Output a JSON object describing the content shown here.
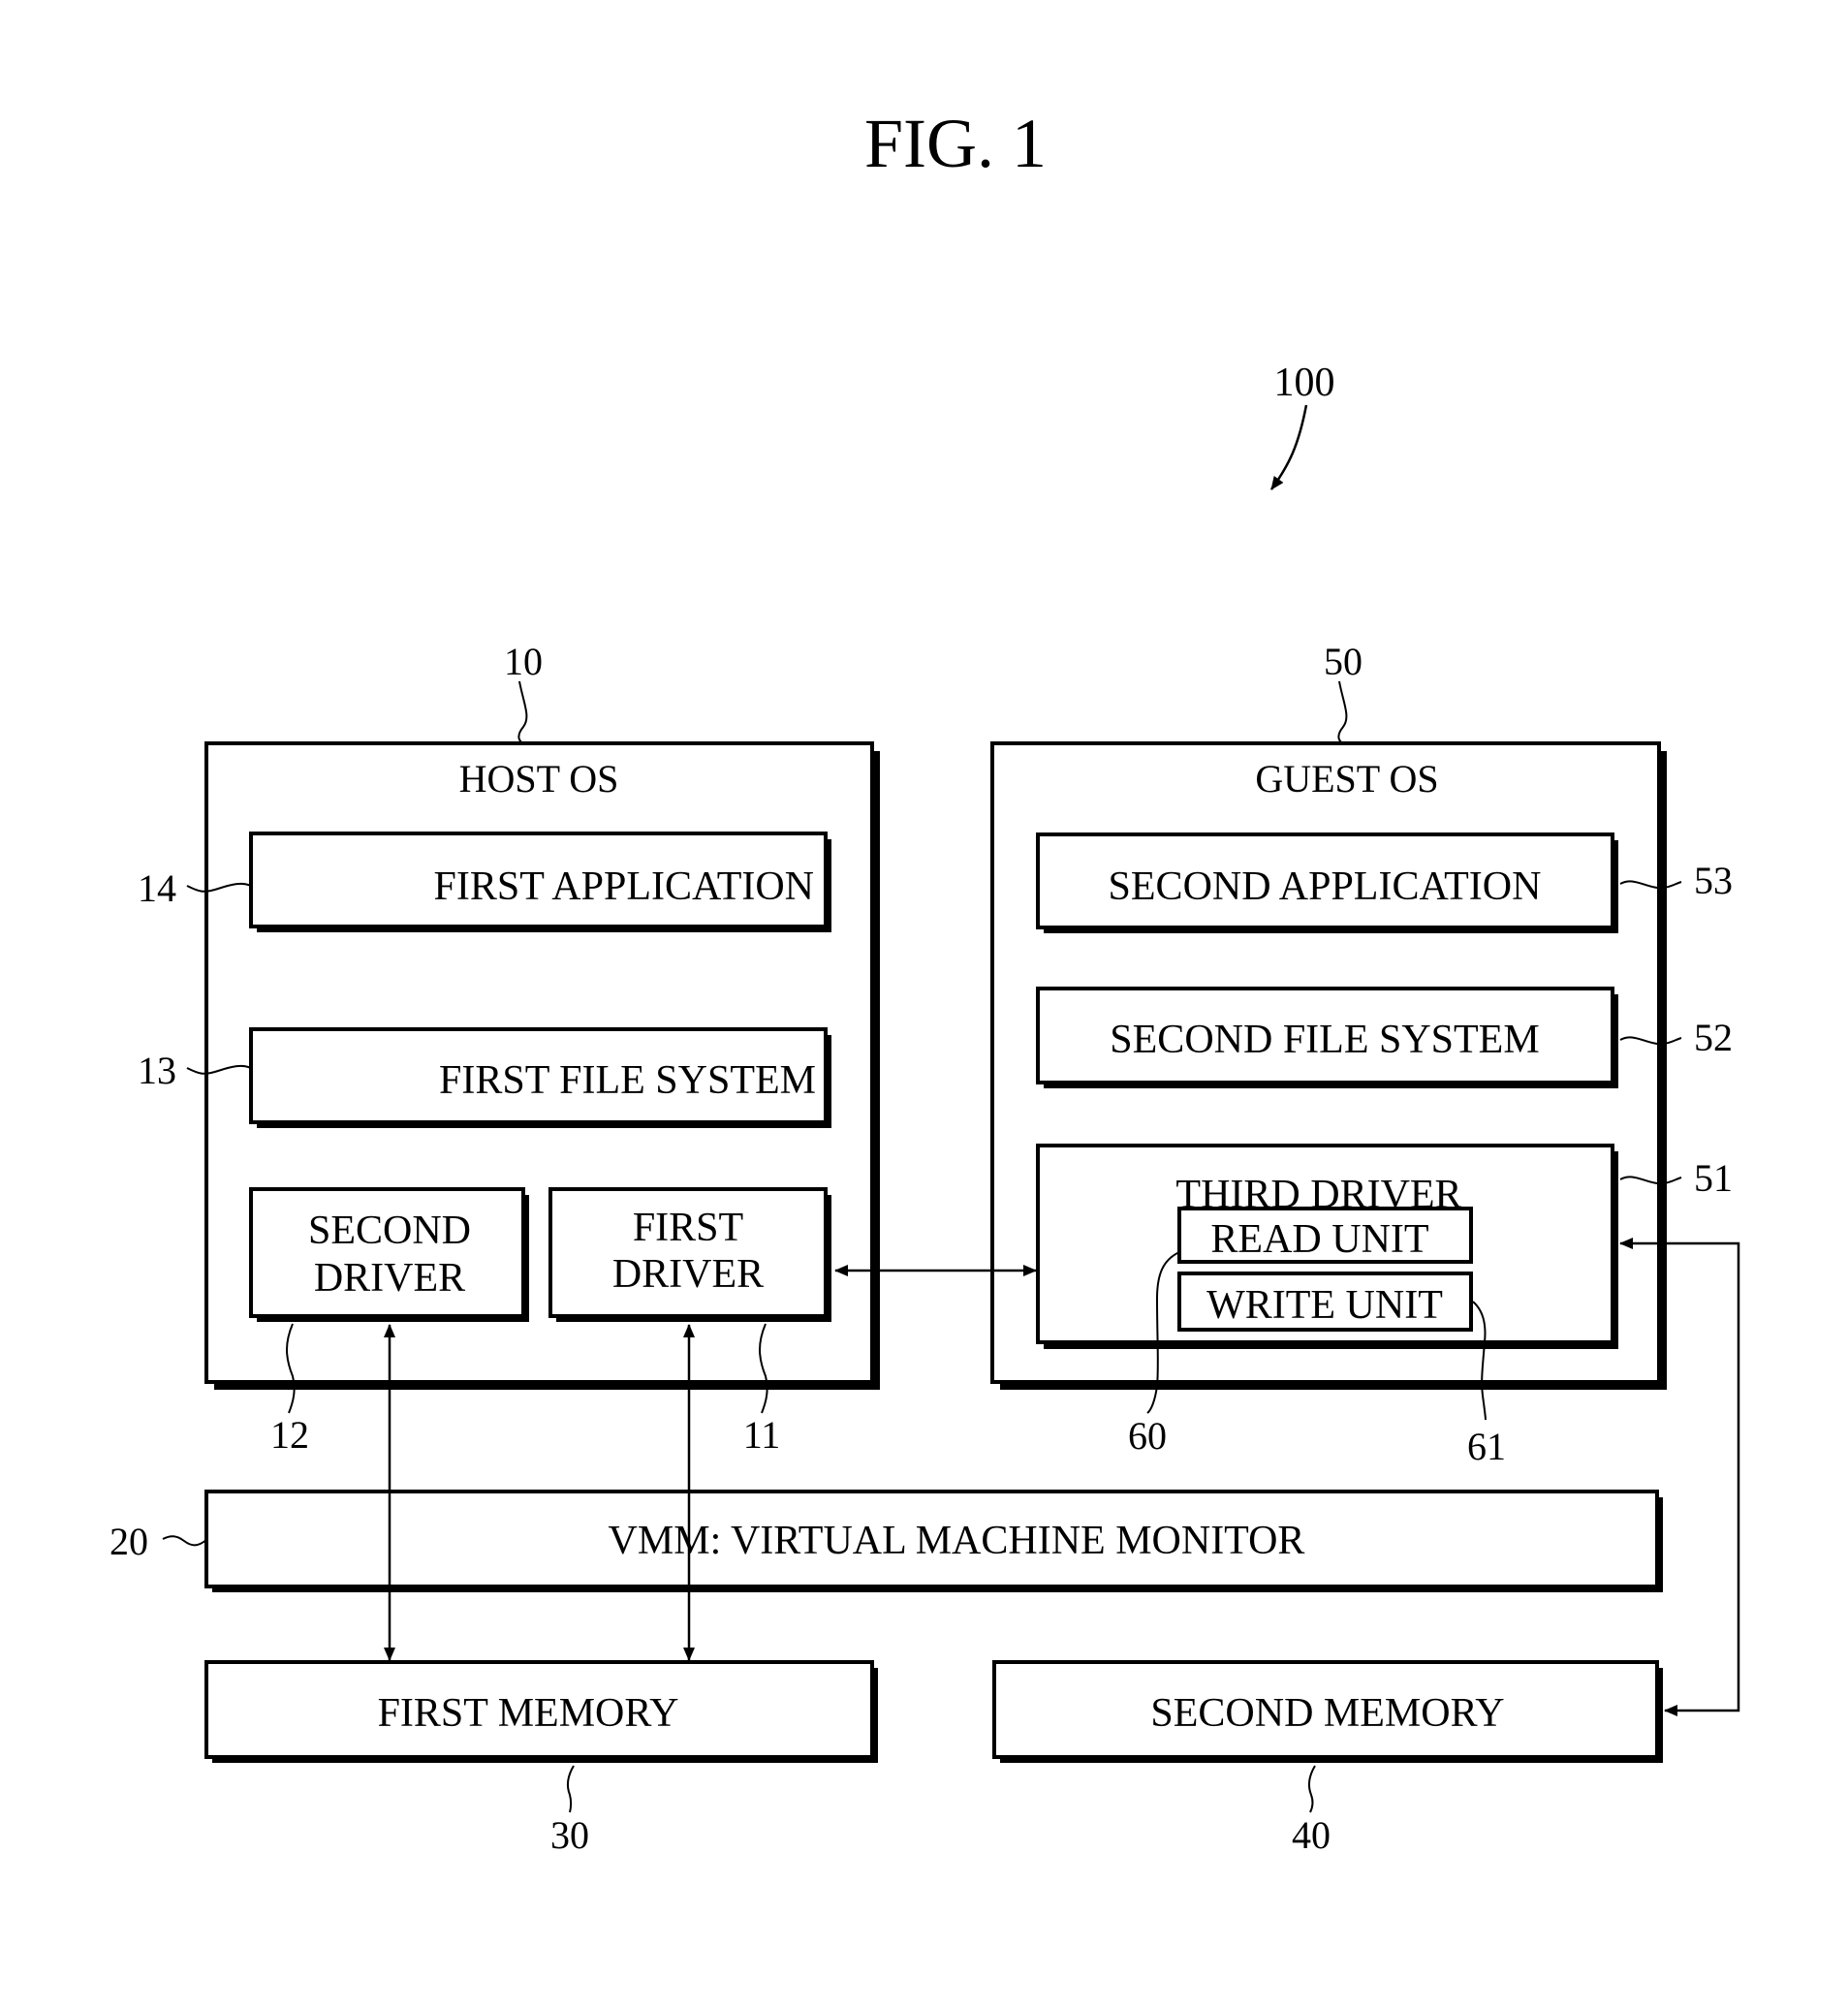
{
  "figure": {
    "title": "FIG. 1",
    "system_ref": "100"
  },
  "host_os": {
    "ref": "10",
    "title": "HOST OS",
    "first_application": {
      "ref": "14",
      "label": "FIRST APPLICATION"
    },
    "first_file_system": {
      "ref": "13",
      "label": "FIRST FILE SYSTEM"
    },
    "second_driver": {
      "ref": "12",
      "label_line1": "SECOND",
      "label_line2": "DRIVER"
    },
    "first_driver": {
      "ref": "11",
      "label_line1": "FIRST",
      "label_line2": "DRIVER"
    }
  },
  "guest_os": {
    "ref": "50",
    "title": "GUEST OS",
    "second_application": {
      "ref": "53",
      "label": "SECOND APPLICATION"
    },
    "second_file_system": {
      "ref": "52",
      "label": "SECOND FILE SYSTEM"
    },
    "third_driver": {
      "ref": "51",
      "label": "THIRD DRIVER",
      "read_unit": {
        "ref": "60",
        "label": "READ UNIT"
      },
      "write_unit": {
        "ref": "61",
        "label": "WRITE UNIT"
      }
    }
  },
  "vmm": {
    "ref": "20",
    "label": "VMM: VIRTUAL MACHINE MONITOR"
  },
  "first_memory": {
    "ref": "30",
    "label": "FIRST MEMORY"
  },
  "second_memory": {
    "ref": "40",
    "label": "SECOND MEMORY"
  },
  "connections": [
    {
      "from": "first_driver",
      "to": "third_driver",
      "direction": "bidirectional"
    },
    {
      "from": "second_driver",
      "to": "first_memory",
      "direction": "bidirectional"
    },
    {
      "from": "first_driver",
      "to": "first_memory",
      "direction": "bidirectional"
    },
    {
      "from": "third_driver",
      "to": "second_memory",
      "direction": "bidirectional"
    }
  ]
}
